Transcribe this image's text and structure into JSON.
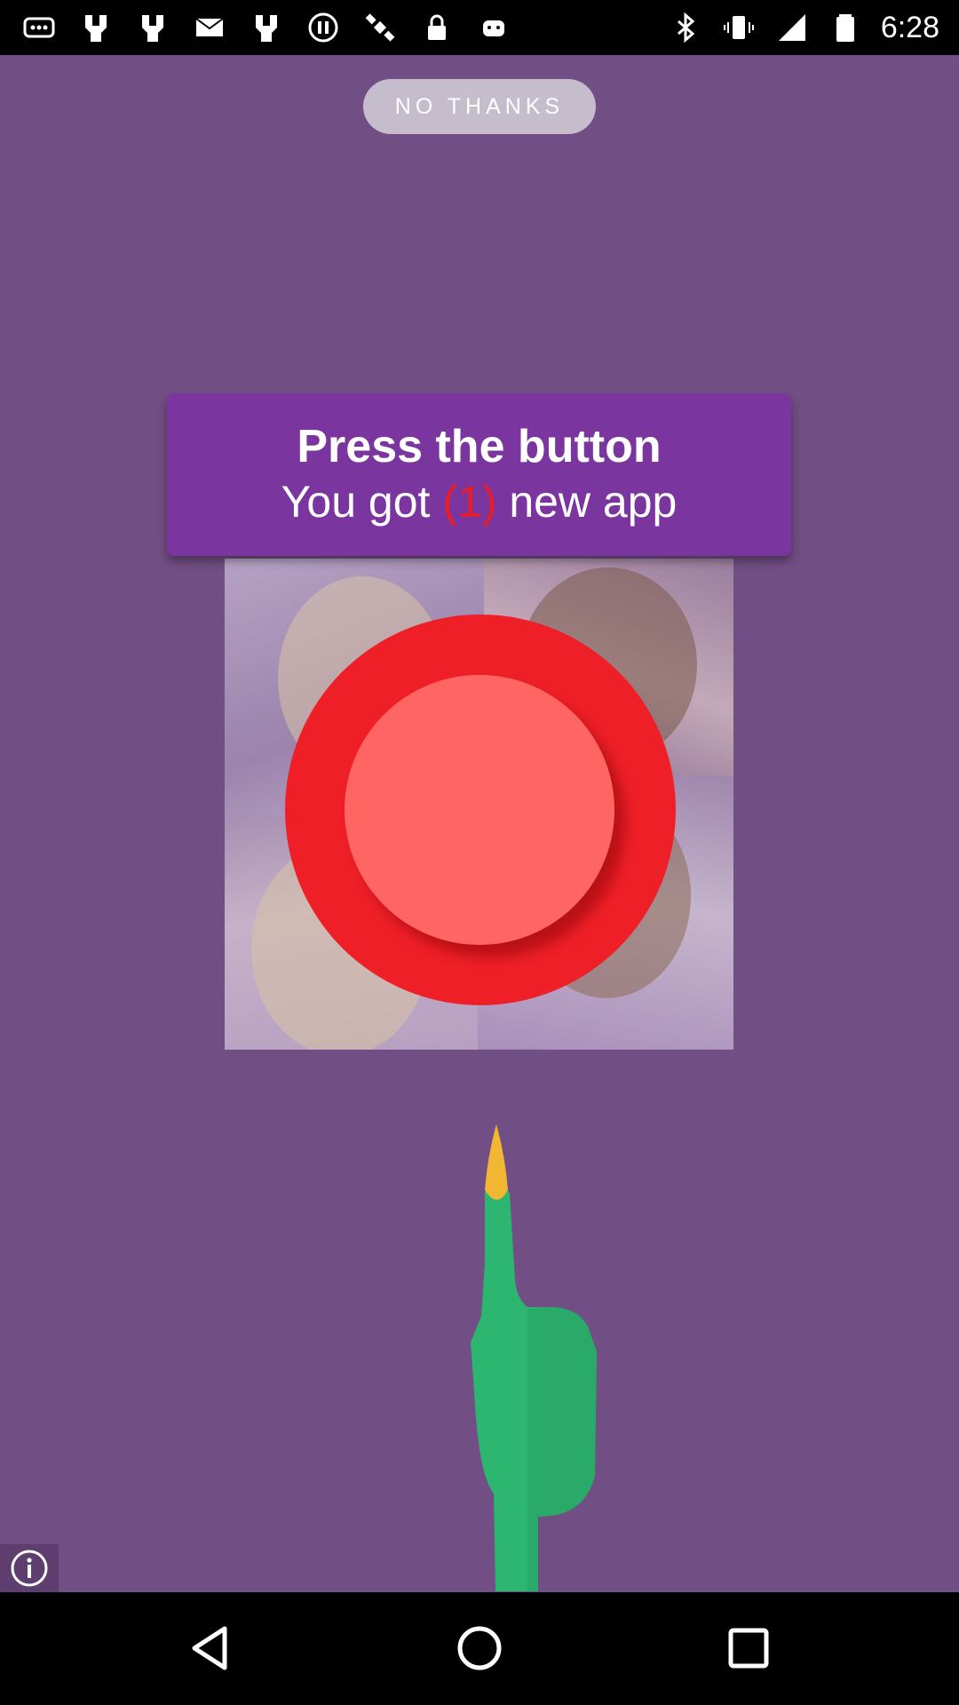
{
  "status_bar": {
    "time": "6:28",
    "icons_left": [
      "more-icon",
      "fork-icon",
      "fork-icon",
      "mail-icon",
      "fork-icon",
      "pause-icon",
      "satellite-icon",
      "lock-icon",
      "android-icon"
    ],
    "icons_right": [
      "bluetooth-icon",
      "vibrate-icon",
      "signal-icon",
      "battery-icon"
    ]
  },
  "no_thanks_label": "NO THANKS",
  "banner": {
    "line1": "Press the button",
    "line2_prefix": "You got ",
    "line2_count": "(1)",
    "line2_suffix": " new app"
  },
  "colors": {
    "background": "#714e84",
    "banner": "#7b359e",
    "button_outer": "#ef1f27",
    "button_inner": "#ff6663",
    "hand": "#2db670"
  },
  "nav": [
    "back-icon",
    "home-icon",
    "recents-icon"
  ]
}
